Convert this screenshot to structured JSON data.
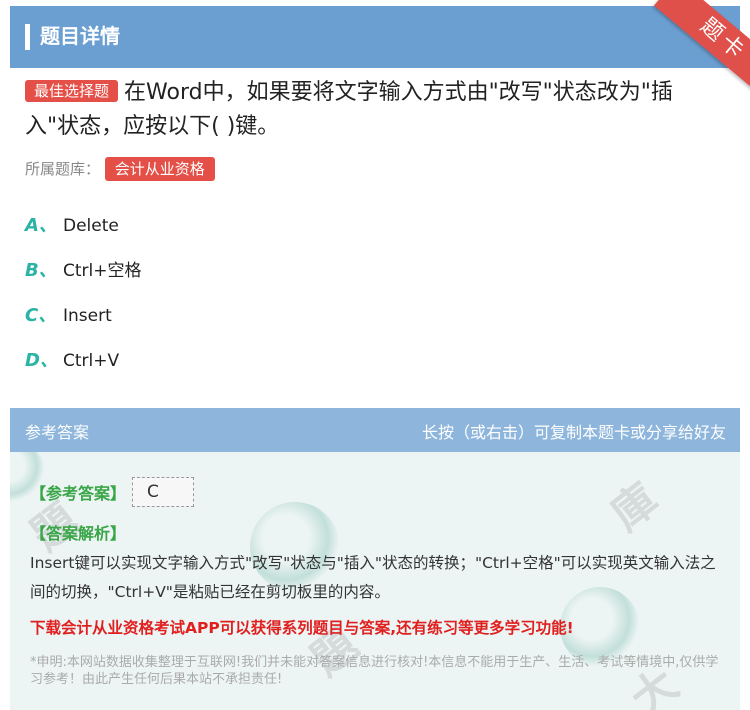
{
  "header": {
    "title": "题目详情"
  },
  "ribbon": {
    "label": "题卡"
  },
  "question": {
    "badge": "最佳选择题",
    "text": "在Word中，如果要将文字输入方式由\"改写\"状态改为\"插入\"状态，应按以下( )键。"
  },
  "source": {
    "label": "所属题库：",
    "tag": "会计从业资格"
  },
  "options": [
    {
      "letter": "A、",
      "text": "Delete"
    },
    {
      "letter": "B、",
      "text": "Ctrl+空格"
    },
    {
      "letter": "C、",
      "text": "Insert"
    },
    {
      "letter": "D、",
      "text": "Ctrl+V"
    }
  ],
  "answer_header": {
    "left": "参考答案",
    "right": "长按（或右击）可复制本题卡或分享给好友"
  },
  "answer": {
    "label": "【参考答案】",
    "value": "C",
    "explanation_label": "【答案解析】",
    "explanation": "Insert键可以实现文字输入方式\"改写\"状态与\"插入\"状态的转换；\"Ctrl+空格\"可以实现英文输入法之间的切换，\"Ctrl+V\"是粘贴已经在剪切板里的内容。",
    "promo": "下载会计从业资格考试APP可以获得系列题目与答案,还有练习等更多学习功能!",
    "disclaimer": "*申明:本网站数据收集整理于互联网!我们并未能对答案信息进行核对!本信息不能用于生产、生活、考试等情境中,仅供学习参考！由此产生任何后果本站不承担责任!"
  }
}
